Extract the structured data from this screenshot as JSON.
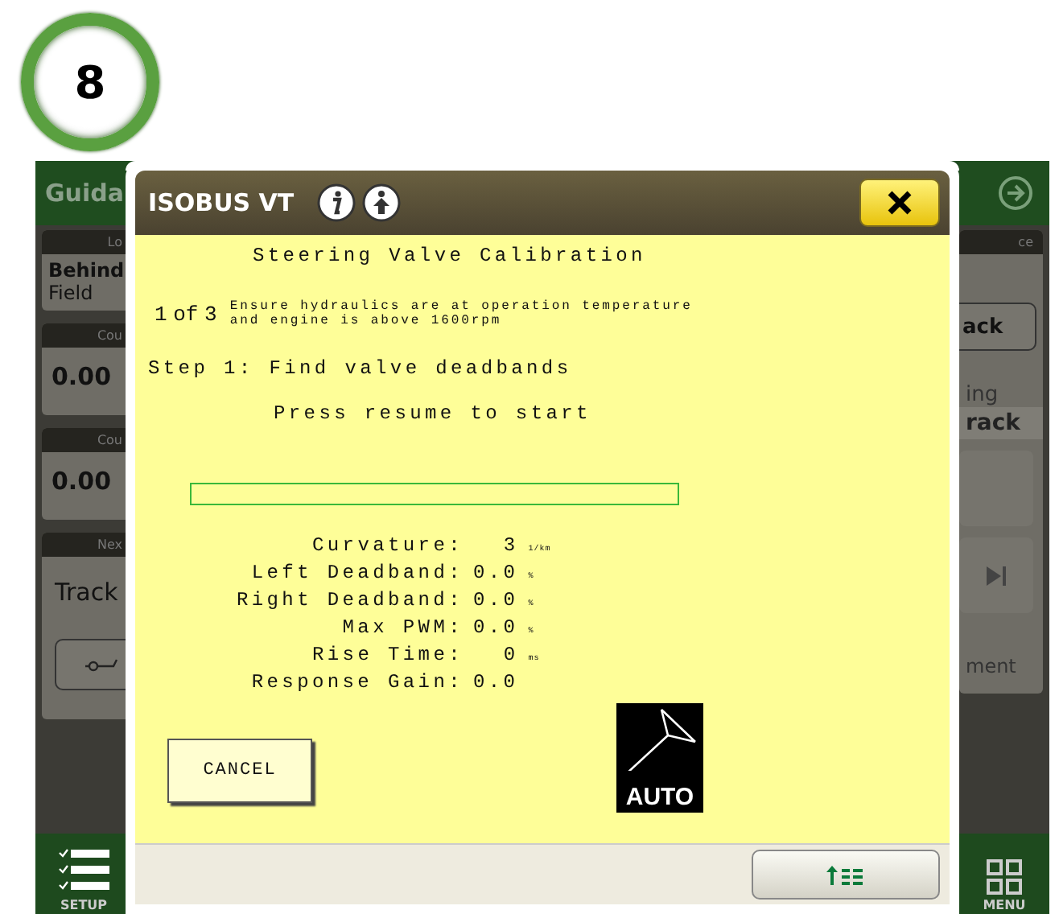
{
  "step_badge": "8",
  "background": {
    "header_title": "Guida",
    "location": {
      "label": "Lo",
      "name": "Behind",
      "value": "Field"
    },
    "counters": [
      {
        "label": "Cou",
        "value": "0.00"
      },
      {
        "label": "Cou",
        "value": "0.00"
      }
    ],
    "next": {
      "label": "Nex",
      "value": "Track"
    },
    "right": {
      "label": "ce",
      "button": "ack",
      "status": "ing",
      "row": "rack",
      "footer": "ment"
    },
    "setup_label": "SETUP",
    "menu_label": "MENU"
  },
  "dialog": {
    "title": "ISOBUS VT",
    "heading": "Steering Valve Calibration",
    "step_count": "1 of 3",
    "note_lines": [
      "Ensure hydraulics are at operation temperature",
      "and engine is above 1600rpm"
    ],
    "step": "Step 1: Find valve deadbands",
    "instruction": "Press resume to start",
    "progress": {
      "level": 0
    },
    "params": [
      {
        "label": "Curvature:",
        "value": "3",
        "unit": "1/km"
      },
      {
        "label": "Left Deadband:",
        "value": "0.0",
        "unit": "%"
      },
      {
        "label": "Right Deadband:",
        "value": "0.0",
        "unit": "%"
      },
      {
        "label": "Max PWM:",
        "value": "0.0",
        "unit": "%"
      },
      {
        "label": "Rise Time:",
        "value": "0",
        "unit": "ms"
      },
      {
        "label": "Response Gain:",
        "value": "0.0"
      }
    ],
    "cancel": "CANCEL",
    "auto_label": "AUTO"
  }
}
